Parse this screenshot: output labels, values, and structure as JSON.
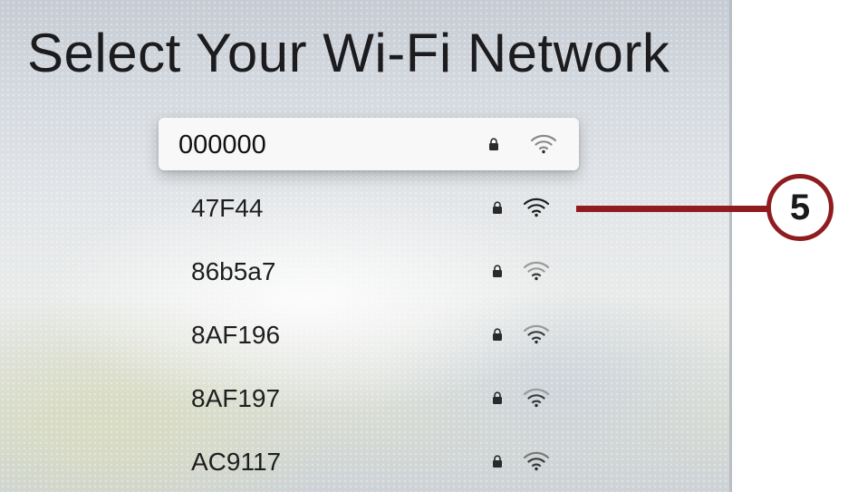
{
  "screen": {
    "title": "Select Your Wi-Fi Network"
  },
  "networks": [
    {
      "name": "000000",
      "secured": true,
      "focused": true,
      "lock_icon": "lock-icon",
      "signal_icon": "wifi-icon"
    },
    {
      "name": "47F44",
      "secured": true,
      "focused": false,
      "lock_icon": "lock-icon",
      "signal_icon": "wifi-icon"
    },
    {
      "name": "86b5a7",
      "secured": true,
      "focused": false,
      "lock_icon": "lock-icon",
      "signal_icon": "wifi-icon"
    },
    {
      "name": "8AF196",
      "secured": true,
      "focused": false,
      "lock_icon": "lock-icon",
      "signal_icon": "wifi-icon"
    },
    {
      "name": "8AF197",
      "secured": true,
      "focused": false,
      "lock_icon": "lock-icon",
      "signal_icon": "wifi-icon"
    },
    {
      "name": "AC9117",
      "secured": true,
      "focused": false,
      "lock_icon": "lock-icon",
      "signal_icon": "wifi-icon"
    }
  ],
  "callout": {
    "number": "5",
    "color": "#8f1c1f"
  }
}
